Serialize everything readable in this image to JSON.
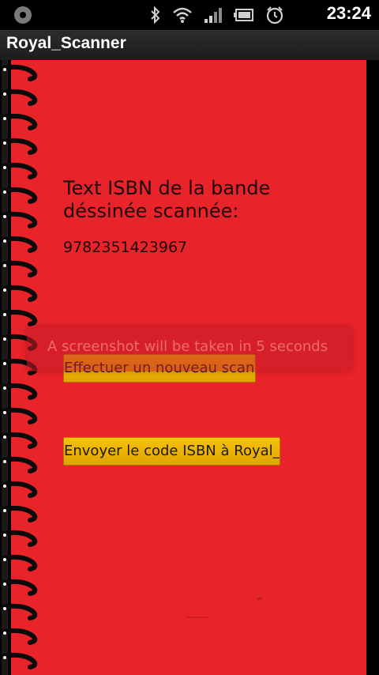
{
  "status_bar": {
    "time": "23:24",
    "icons": [
      "app-notification-icon",
      "bluetooth-icon",
      "wifi-icon",
      "signal-icon",
      "battery-icon",
      "alarm-clock-icon"
    ]
  },
  "app": {
    "title": "Royal_Scanner"
  },
  "main": {
    "isbn_heading": "Text ISBN de la bande déssinée scannée:",
    "isbn_value": "9782351423967",
    "scan_button_label": "Effectuer un nouveau scan",
    "send_button_label": "Envoyer le code ISBN à Royal_"
  },
  "toast": {
    "message": "A screenshot will be taken in 5 seconds"
  },
  "colors": {
    "paper": "#e8232a",
    "button": "#f2b705",
    "background": "#000000"
  }
}
